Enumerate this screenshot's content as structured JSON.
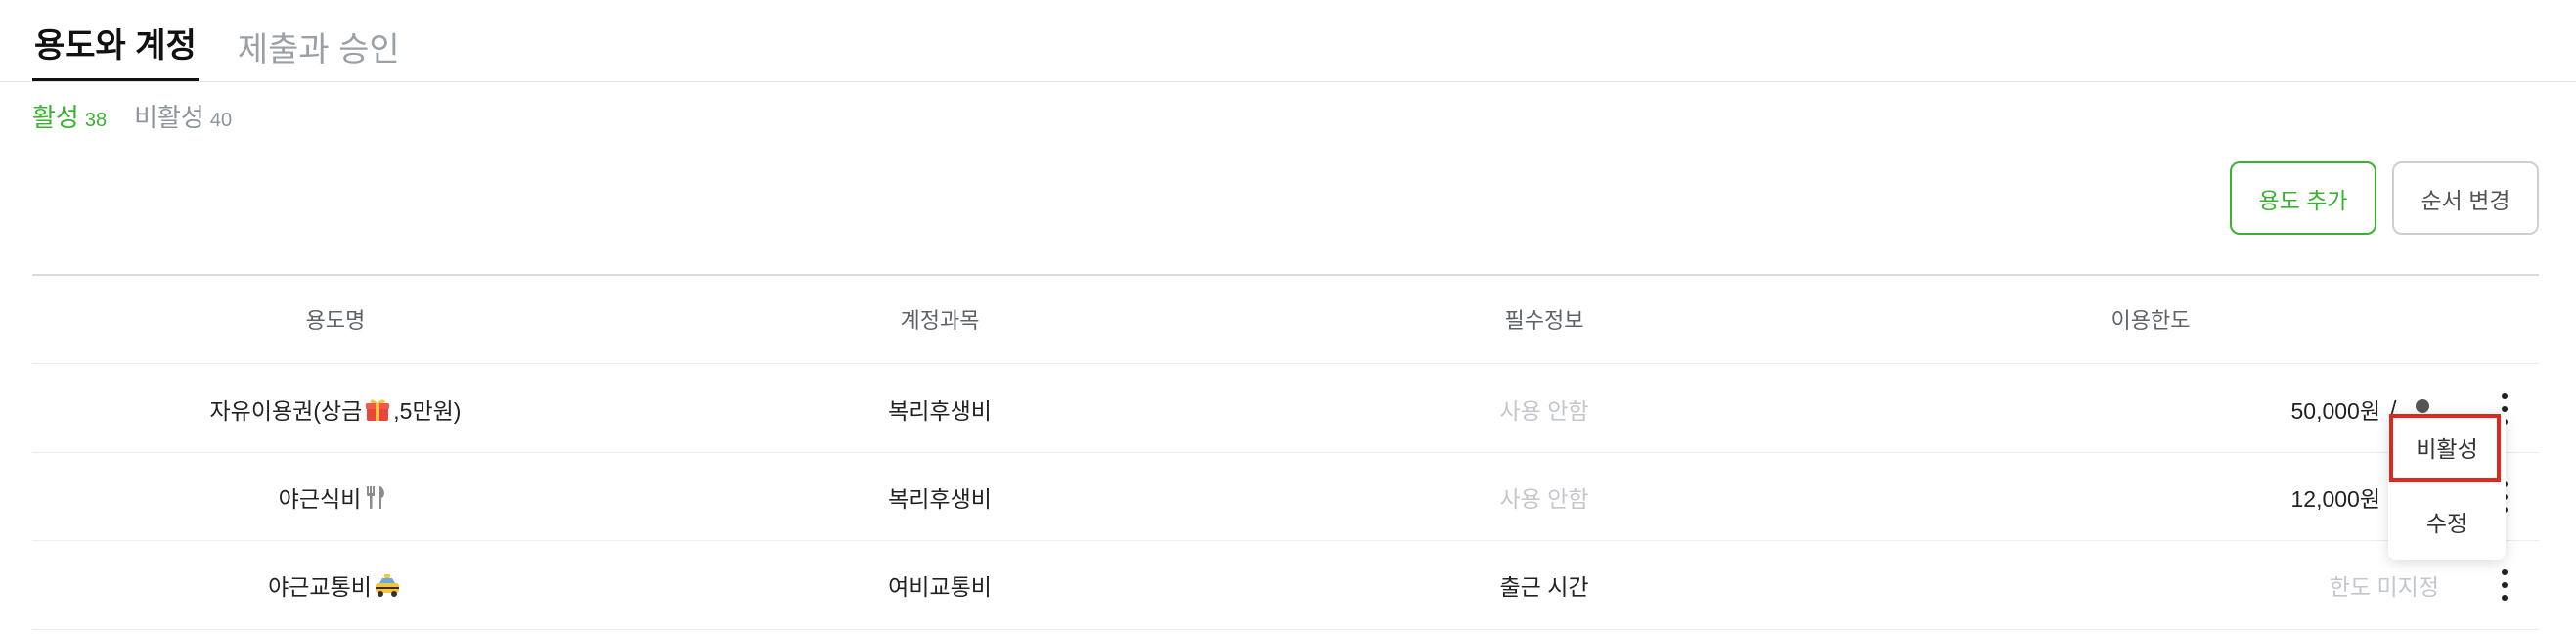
{
  "tabs": [
    {
      "label": "용도와 계정",
      "active": true
    },
    {
      "label": "제출과 승인",
      "active": false
    }
  ],
  "filters": {
    "active": {
      "label": "활성",
      "count": "38"
    },
    "inactive": {
      "label": "비활성",
      "count": "40"
    }
  },
  "actions": {
    "add_label": "용도 추가",
    "reorder_label": "순서 변경"
  },
  "table": {
    "headers": [
      "용도명",
      "계정과목",
      "필수정보",
      "이용한도"
    ],
    "rows": [
      {
        "name": "자유이용권(상금",
        "name_suffix": ",5만원)",
        "name_icon": "gift-icon",
        "account": "복리후생비",
        "required": "사용 안함",
        "limit": "50,000원",
        "limit_sep": "/"
      },
      {
        "name": "야근식비",
        "name_icon": "fork-knife-icon",
        "account": "복리후생비",
        "required": "사용 안함",
        "limit": "12,000원"
      },
      {
        "name": "야근교통비",
        "name_icon": "taxi-icon",
        "account": "여비교통비",
        "required": "출근 시간",
        "limit": "한도 미지정"
      }
    ]
  },
  "context_menu": {
    "items": [
      "비활성",
      "수정"
    ]
  },
  "colors": {
    "accent": "#3bb130",
    "highlight": "#e0271e",
    "muted": "#c3c7cc"
  }
}
